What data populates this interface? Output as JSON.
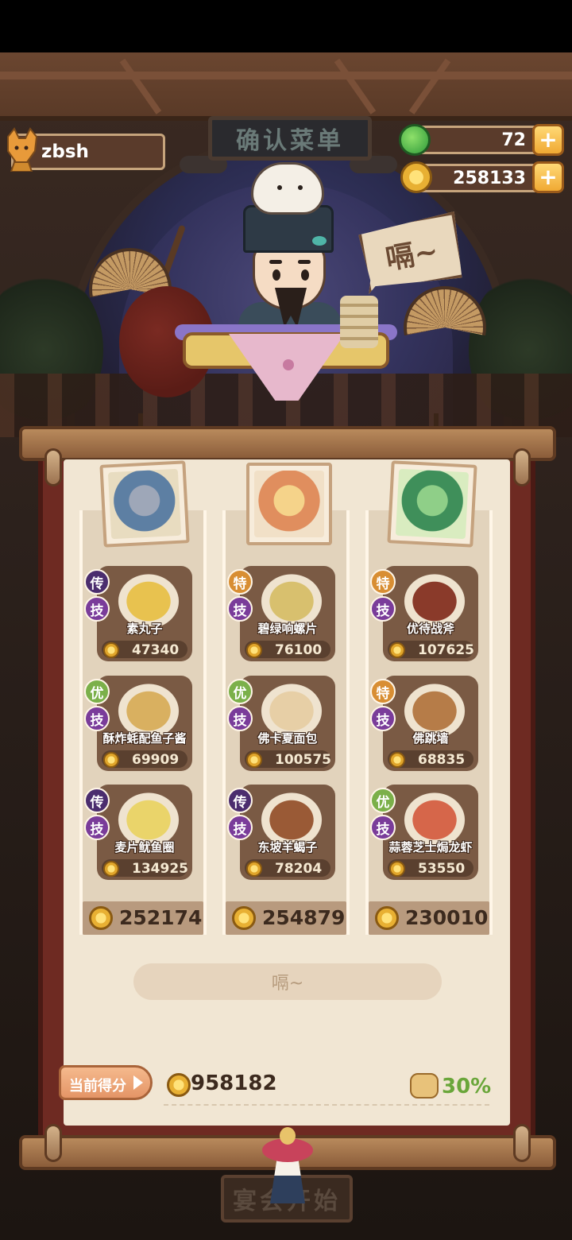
{
  "app": {
    "title_sign": "确认菜单",
    "speech_bubble": "嗝~"
  },
  "player": {
    "name": "zbsh",
    "icon": "fox-character-icon"
  },
  "resources": [
    {
      "name": "green-gem",
      "icon": "green-apple-icon",
      "value": "72",
      "plus": "+"
    },
    {
      "name": "coins",
      "icon": "gold-coin-icon",
      "value": "258133",
      "plus": "+"
    }
  ],
  "columns": [
    {
      "guest": "gray-wolf-guest-portrait",
      "total": "252174",
      "dishes": [
        {
          "rank": "传",
          "rank_type": "legend",
          "skill": "技",
          "name": "素丸子",
          "price": "47340",
          "color": "#e8c24f"
        },
        {
          "rank": "优",
          "rank_type": "excellent",
          "skill": "技",
          "name": "酥炸蚝配鱼子酱",
          "price": "69909",
          "color": "#d9b060"
        },
        {
          "rank": "传",
          "rank_type": "legend",
          "skill": "技",
          "name": "麦片鱿鱼圈",
          "price": "134925",
          "color": "#ead46a"
        }
      ]
    },
    {
      "guest": "blonde-girl-guest-portrait",
      "total": "254879",
      "dishes": [
        {
          "rank": "特",
          "rank_type": "special",
          "skill": "技",
          "name": "碧绿响螺片",
          "price": "76100",
          "color": "#d8c06e"
        },
        {
          "rank": "优",
          "rank_type": "excellent",
          "skill": "技",
          "name": "佛卡夏面包",
          "price": "100575",
          "color": "#e7cfa6"
        },
        {
          "rank": "传",
          "rank_type": "legend",
          "skill": "技",
          "name": "东坡羊蝎子",
          "price": "78204",
          "color": "#9a5a36"
        }
      ]
    },
    {
      "guest": "green-haired-guest-portrait",
      "total": "230010",
      "dishes": [
        {
          "rank": "特",
          "rank_type": "special",
          "skill": "技",
          "name": "优待战斧",
          "price": "107625",
          "color": "#8a3a2a"
        },
        {
          "rank": "特",
          "rank_type": "special",
          "skill": "技",
          "name": "佛跳墙",
          "price": "68835",
          "color": "#b67c48"
        },
        {
          "rank": "优",
          "rank_type": "excellent",
          "skill": "技",
          "name": "蒜蓉芝士焗龙虾",
          "price": "53550",
          "color": "#d6664a"
        }
      ]
    }
  ],
  "burp_bar": "嗝~",
  "score": {
    "label": "当前得分",
    "value": "958182",
    "bonus": "30%"
  },
  "start_button": "宴会开始",
  "colors": {
    "accent_gold": "#f0a933",
    "bonus_green": "#6aa63a",
    "board_red": "#6e2a22"
  }
}
